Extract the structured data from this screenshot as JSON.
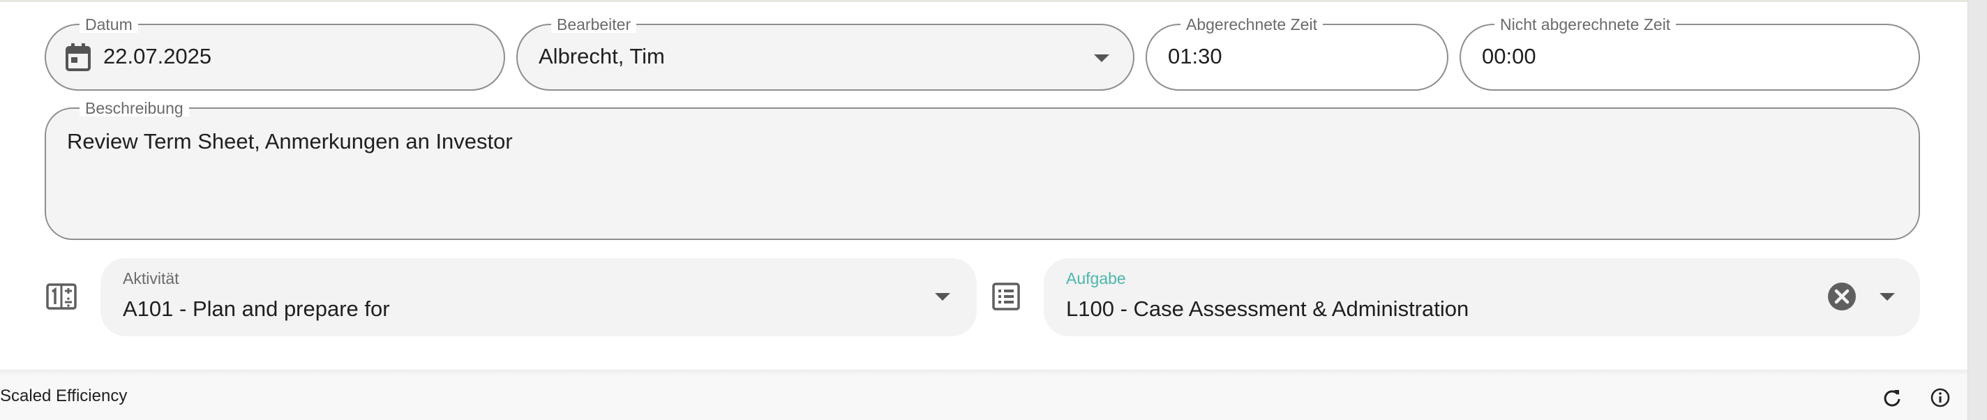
{
  "form": {
    "datum": {
      "label": "Datum",
      "value": "22.07.2025",
      "icon": "calendar-icon"
    },
    "bearbeiter": {
      "label": "Bearbeiter",
      "value": "Albrecht, Tim"
    },
    "abgerechnete_zeit": {
      "label": "Abgerechnete Zeit",
      "value": "01:30"
    },
    "nicht_abgerechnete_zeit": {
      "label": "Nicht abgerechnete Zeit",
      "value": "00:00"
    },
    "beschreibung": {
      "label": "Beschreibung",
      "value": "Review Term Sheet, Anmerkungen an Investor"
    },
    "aktivitaet": {
      "label": "Aktivität",
      "value": "A101 - Plan and prepare for",
      "icon": "activity-code-icon"
    },
    "aufgabe": {
      "label": "Aufgabe",
      "value": "L100 - Case Assessment & Administration",
      "icon": "task-list-icon"
    }
  },
  "footer": {
    "title": "Scaled Efficiency",
    "icons": [
      "refresh-icon",
      "info-icon"
    ]
  },
  "colors": {
    "accent": "#4db6ac",
    "outline": "#8e8e8e",
    "field_fill": "#f4f4f4"
  }
}
